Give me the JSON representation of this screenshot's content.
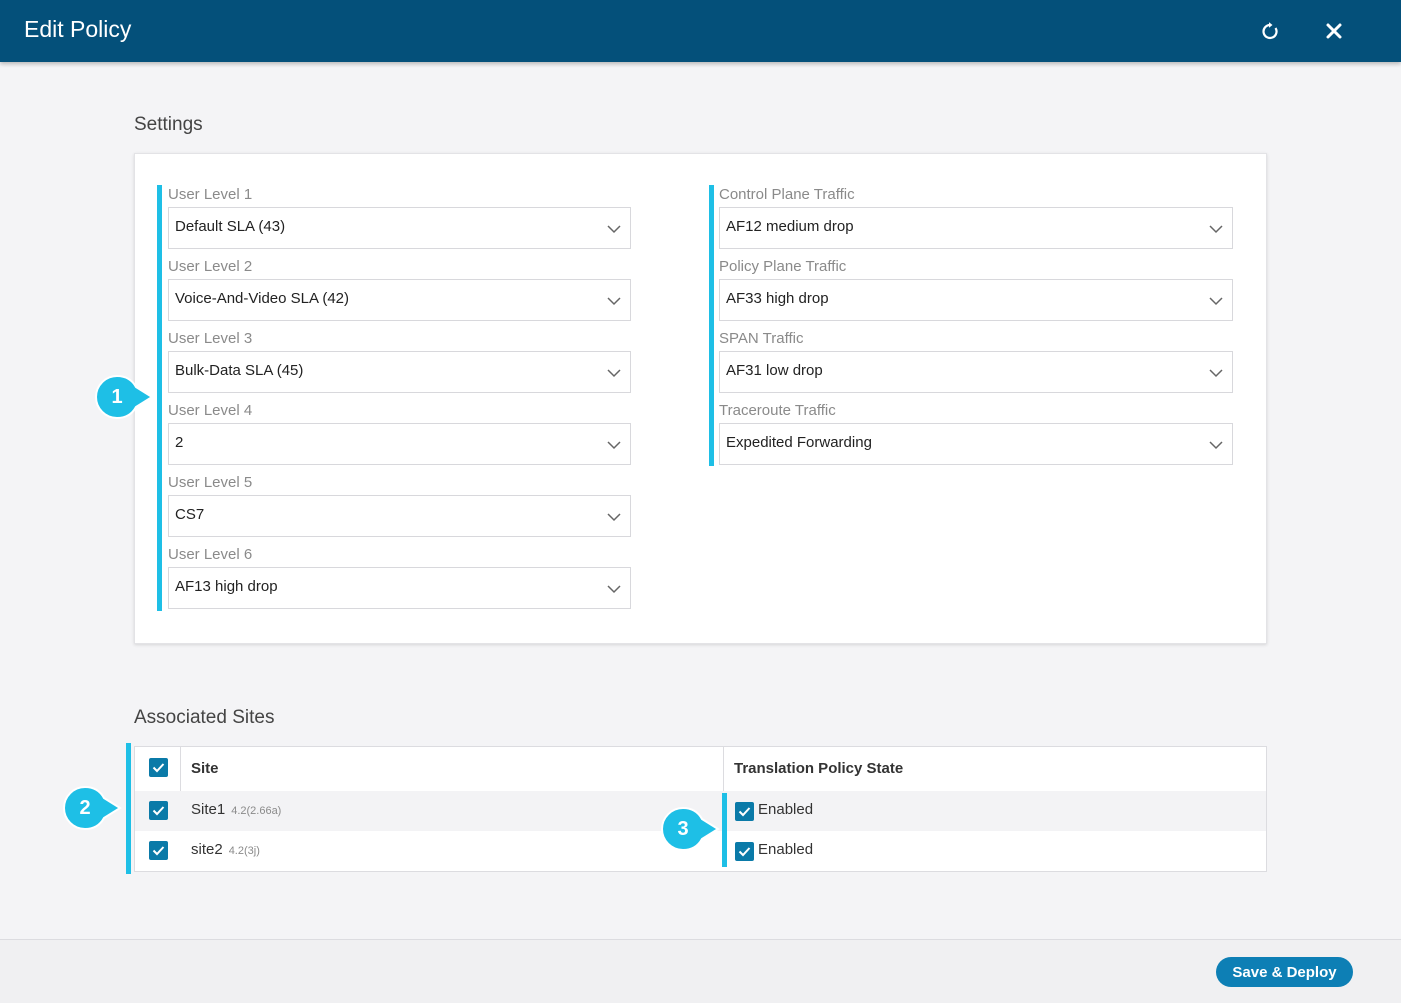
{
  "header": {
    "title": "Edit Policy",
    "refresh_icon": "refresh-icon",
    "close_icon": "close-icon",
    "bg_color": "#04507a"
  },
  "settings": {
    "title": "Settings",
    "left_fields": [
      {
        "label": "User Level 1",
        "value": "Default SLA (43)"
      },
      {
        "label": "User Level 2",
        "value": "Voice-And-Video SLA (42)"
      },
      {
        "label": "User Level 3",
        "value": "Bulk-Data SLA (45)"
      },
      {
        "label": "User Level 4",
        "value": "2"
      },
      {
        "label": "User Level 5",
        "value": "CS7"
      },
      {
        "label": "User Level 6",
        "value": "AF13 high drop"
      }
    ],
    "right_fields": [
      {
        "label": "Control Plane Traffic",
        "value": "AF12 medium drop"
      },
      {
        "label": "Policy Plane Traffic",
        "value": "AF33 high drop"
      },
      {
        "label": "SPAN Traffic",
        "value": "AF31 low drop"
      },
      {
        "label": "Traceroute Traffic",
        "value": "Expedited Forwarding"
      }
    ]
  },
  "associated_sites": {
    "title": "Associated Sites",
    "columns": [
      "Site",
      "Translation Policy State"
    ],
    "rows": [
      {
        "site": "Site1",
        "version": "4.2(2.66a)",
        "state": "Enabled",
        "checked": true
      },
      {
        "site": "site2",
        "version": "4.2(3j)",
        "state": "Enabled",
        "checked": true
      }
    ]
  },
  "callouts": [
    "1",
    "2",
    "3"
  ],
  "footer": {
    "save_label": "Save & Deploy"
  },
  "colors": {
    "accent": "#1ebfe6",
    "checkbox": "#0a7aa8",
    "button": "#0d7fb5"
  }
}
